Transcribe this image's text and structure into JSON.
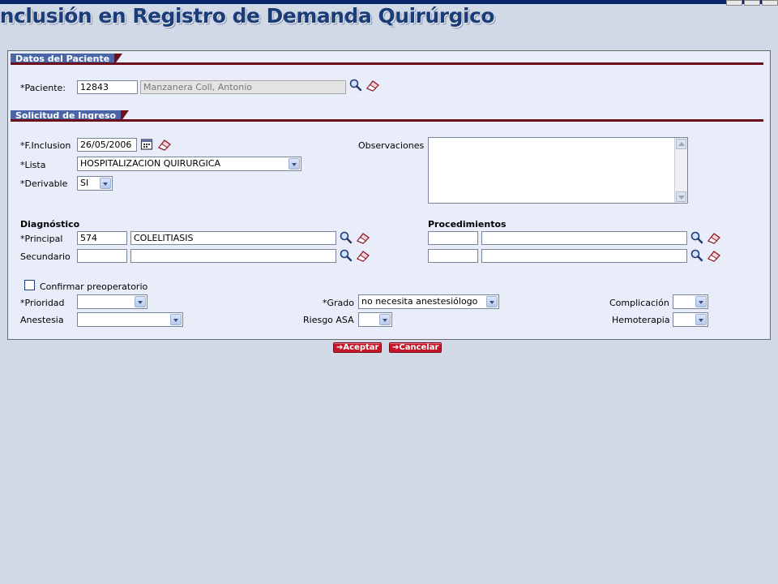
{
  "page": {
    "title": "Inclusión en Registro de Demanda Quirúrgico"
  },
  "paciente_section": {
    "title": "Datos del Paciente",
    "paciente_label": "*Paciente:",
    "paciente_id": "12843",
    "paciente_name": "Manzanera Coll, Antonio"
  },
  "solicitud_section": {
    "title": "Solicitud de Ingreso",
    "f_inclusion_label": "*F.Inclusion",
    "f_inclusion_value": "26/05/2006",
    "lista_label": "*Lista",
    "lista_value": "HOSPITALIZACION QUIRURGICA",
    "derivable_label": "*Derivable",
    "derivable_value": "SI",
    "observaciones_label": "Observaciones",
    "observaciones_value": ""
  },
  "diagnostico": {
    "title": "Diagnóstico",
    "principal_label": "*Principal",
    "principal_code": "574",
    "principal_desc": "COLELITIASIS",
    "secundario_label": "Secundario",
    "secundario_code": "",
    "secundario_desc": ""
  },
  "procedimientos": {
    "title": "Procedimientos",
    "row1_code": "",
    "row1_desc": "",
    "row2_code": "",
    "row2_desc": ""
  },
  "extras": {
    "confirmar_label": "Confirmar preoperatorio",
    "confirmar_checked": false,
    "prioridad_label": "*Prioridad",
    "prioridad_value": "",
    "grado_label": "*Grado",
    "grado_value": "no necesita anestesiólogo",
    "complicacion_label": "Complicación",
    "complicacion_value": "",
    "anestesia_label": "Anestesia",
    "anestesia_value": "",
    "riesgo_label": "Riesgo ASA",
    "riesgo_value": "",
    "hemoterapia_label": "Hemoterapia",
    "hemoterapia_value": ""
  },
  "actions": {
    "aceptar": "Aceptar",
    "cancelar": "Cancelar"
  },
  "icons": {
    "search": "magnifier-icon",
    "clear": "eraser-icon",
    "calendar": "calendar-icon"
  },
  "colors": {
    "section_tab": "#4a66a8",
    "section_line": "#6e0f1e",
    "button": "#c4172c",
    "panel_bg": "#e8edf9",
    "page_bg": "#d2d9e6"
  }
}
